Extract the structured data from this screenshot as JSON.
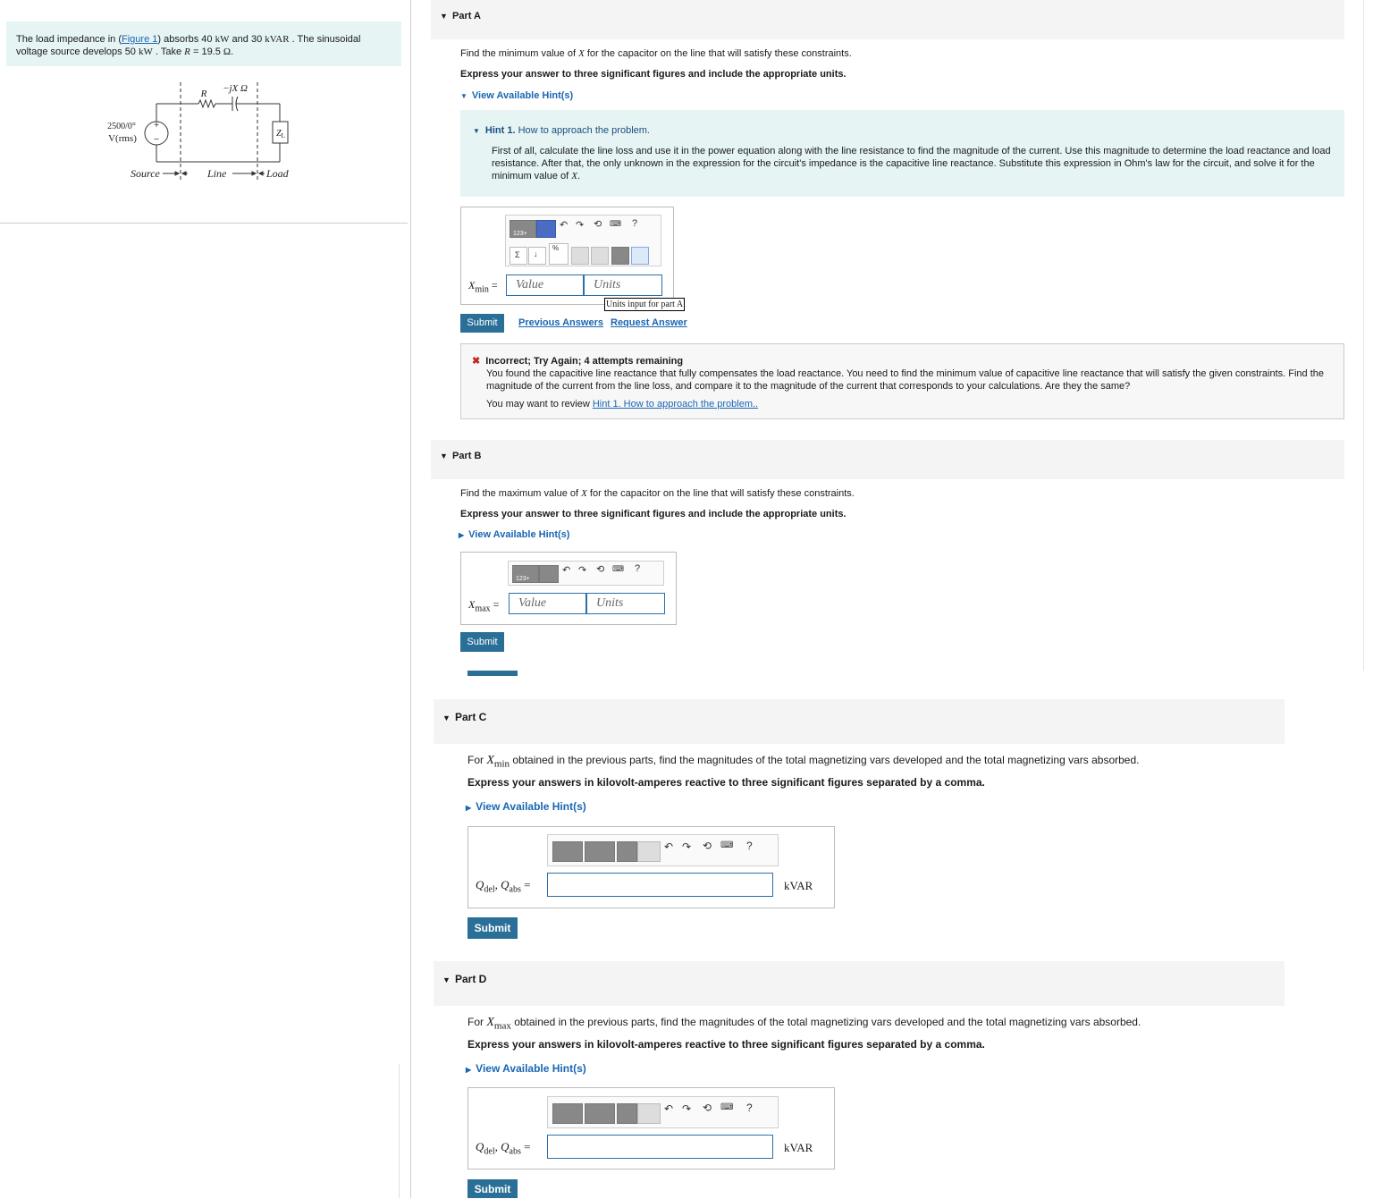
{
  "problem": {
    "t1": "The load impedance in (",
    "figure_link": "Figure 1",
    "t2": ") absorbs 40",
    "kw1": "kW",
    "t3": "and 30",
    "kvar": "kVAR",
    "t4": ". The sinusoidal voltage source develops 50",
    "kw2": "kW",
    "t5": ". Take",
    "R": "R",
    "t6": "= 19.5",
    "ohm": "Ω",
    "t7": "."
  },
  "circuit": {
    "R": "R",
    "X": "−jX Ω",
    "source_voltage": "2500/0°",
    "source_unit": "V(rms)",
    "plus": "+",
    "minus": "−",
    "load_symbol": "Z",
    "load_sub": "L",
    "source_label": "Source",
    "line_label": "Line",
    "load_label": "Load"
  },
  "toolbar": {
    "keypad_label": "123+",
    "help": "?"
  },
  "partA": {
    "title": "Part A",
    "question_pre": "Find the minimum value of",
    "X": "X",
    "question_post": "for the capacitor on the line that will satisfy these constraints.",
    "instruction": "Express your answer to three significant figures and include the appropriate units.",
    "hint_link": "View Available Hint(s)",
    "hint_title_num": "Hint 1.",
    "hint_title": "How to approach the problem.",
    "hint_body": "First of all, calculate the line loss and use it in the power equation along with the line resistance to find the magnitude of the current. Use this magnitude to determine the load reactance and load resistance. After that, the only unknown in the expression for the circuit's impedance is the capacitive line reactance. Substitute this expression in Ohm's law for the circuit, and solve it for the minimum value of",
    "hint_X": "X",
    "hint_end": ".",
    "var": "X",
    "var_sub": "min",
    "equals": "=",
    "value_placeholder": "Value",
    "units_placeholder": "Units",
    "units_tooltip": "Units input for part A",
    "submit": "Submit",
    "previous_answers": "Previous Answers",
    "request_answer": "Request Answer",
    "feedback_title": "Incorrect; Try Again; 4 attempts remaining",
    "feedback_body": "You found the capacitive line reactance that fully compensates the load reactance. You need to find the minimum value of capacitive line reactance that will satisfy the given constraints. Find the magnitude of the current from the line loss, and compare it to the magnitude of the current that corresponds to your calculations. Are they the same?",
    "review_pre": "You may want to review",
    "review_link": "Hint 1. How to approach the problem.."
  },
  "partB": {
    "title": "Part B",
    "question_pre": "Find the maximum value of",
    "X": "X",
    "question_post": "for the capacitor on the line that will satisfy these constraints.",
    "instruction": "Express your answer to three significant figures and include the appropriate units.",
    "hint_link": "View Available Hint(s)",
    "var": "X",
    "var_sub": "max",
    "equals": "=",
    "value_placeholder": "Value",
    "units_placeholder": "Units",
    "submit": "Submit"
  },
  "partC": {
    "title": "Part C",
    "q_pre": "For",
    "var": "X",
    "var_sub": "min",
    "q_post": "obtained in the previous parts, find the magnitudes of the total magnetizing vars developed and the total magnetizing vars absorbed.",
    "instruction": "Express your answers in kilovolt-amperes reactive to three significant figures separated by a comma.",
    "hint_link": "View Available Hint(s)",
    "label": "Q",
    "label_sub1": "del",
    "label_mid": ", Q",
    "label_sub2": "abs",
    "equals": "=",
    "unit": "kVAR",
    "submit": "Submit"
  },
  "partD": {
    "title": "Part D",
    "q_pre": "For",
    "var": "X",
    "var_sub": "max",
    "q_post": "obtained in the previous parts, find the magnitudes of the total magnetizing vars developed and the total magnetizing vars absorbed.",
    "instruction": "Express your answers in kilovolt-amperes reactive to three significant figures separated by a comma.",
    "hint_link": "View Available Hint(s)",
    "label": "Q",
    "label_sub1": "del",
    "label_mid": ", Q",
    "label_sub2": "abs",
    "equals": "=",
    "unit": "kVAR",
    "submit": "Submit"
  },
  "colors": {
    "accent": "#2a6f97",
    "link": "#1a66b3",
    "hint_bg": "#e6f4f4",
    "error": "#c0271f"
  }
}
